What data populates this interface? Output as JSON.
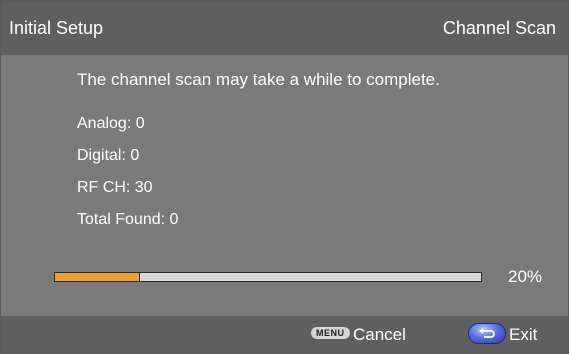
{
  "header": {
    "left_title": "Initial Setup",
    "right_title": "Channel Scan"
  },
  "message": "The channel scan may take a while to complete.",
  "stats": {
    "analog": "Analog: 0",
    "digital": "Digital: 0",
    "rf_ch": "RF CH: 30",
    "total_found": "Total Found: 0"
  },
  "progress": {
    "value": 0.2,
    "label": "20%",
    "fill_color": "#f0a030"
  },
  "footer": {
    "menu_key_label": "MENU",
    "cancel_label": "Cancel",
    "back_key_icon": "back-arrow-icon",
    "exit_label": "Exit"
  }
}
